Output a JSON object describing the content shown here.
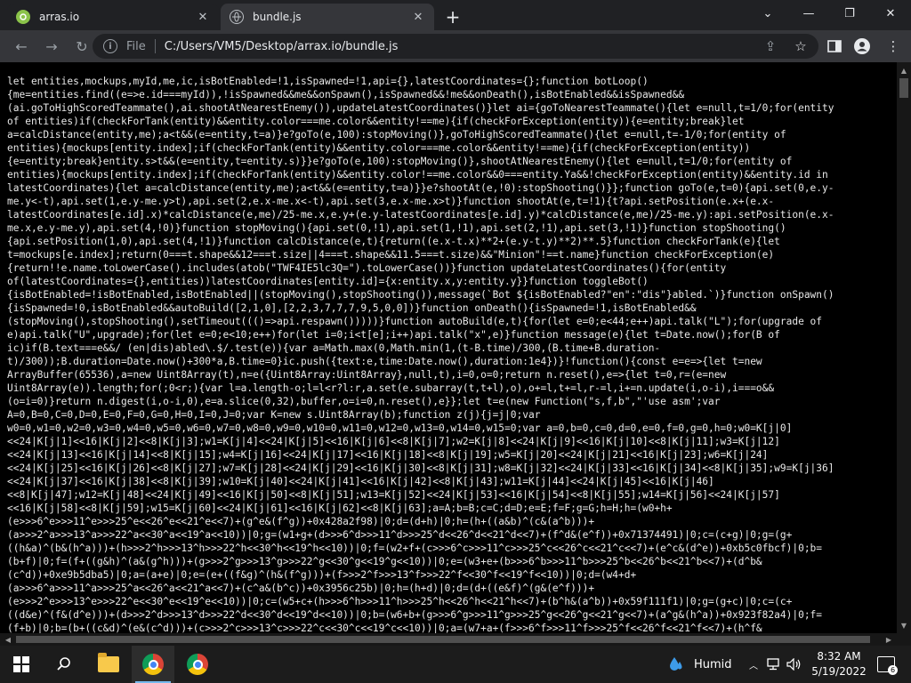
{
  "browser": {
    "tabs": [
      {
        "title": "arras.io",
        "active": false,
        "icon": "arras-icon"
      },
      {
        "title": "bundle.js",
        "active": true,
        "icon": "globe-icon"
      }
    ],
    "address": {
      "scheme": "File",
      "url": "C:/Users/VM5/Desktop/arrax.io/bundle.js"
    }
  },
  "code_lines": [
    "let entities,mockups,myId,me,ic,isBotEnabled=!1,isSpawned=!1,api={},latestCoordinates={};function botLoop()",
    "{me=entities.find((e=>e.id===myId)),!isSpawned&&me&&onSpawn(),isSpawned&&!me&&onDeath(),isBotEnabled&&isSpawned&&",
    "(ai.goToHighScoredTeammate(),ai.shootAtNearestEnemy()),updateLatestCoordinates()}let ai={goToNearestTeammate(){let e=null,t=1/0;for(entity",
    "of entities)if(checkForTank(entity)&&entity.color===me.color&&entity!==me){if(checkForException(entity)){e=entity;break}let",
    "a=calcDistance(entity,me);a<t&&(e=entity,t=a)}e?goTo(e,100):stopMoving()},goToHighScoredTeammate(){let e=null,t=-1/0;for(entity of",
    "entities){mockups[entity.index];if(checkForTank(entity)&&entity.color===me.color&&entity!==me){if(checkForException(entity))",
    "{e=entity;break}entity.s>t&&(e=entity,t=entity.s)}}e?goTo(e,100):stopMoving()},shootAtNearestEnemy(){let e=null,t=1/0;for(entity of",
    "entities){mockups[entity.index];if(checkForTank(entity)&&entity.color!==me.color&&0===entity.Ya&&!checkForException(entity)&&entity.id in",
    "latestCoordinates){let a=calcDistance(entity,me);a<t&&(e=entity,t=a)}}e?shootAt(e,!0):stopShooting()}};function goTo(e,t=0){api.set(0,e.y-",
    "me.y<-t),api.set(1,e.y-me.y>t),api.set(2,e.x-me.x<-t),api.set(3,e.x-me.x>t)}function shootAt(e,t=!1){t?api.setPosition(e.x+(e.x-",
    "latestCoordinates[e.id].x)*calcDistance(e,me)/25-me.x,e.y+(e.y-latestCoordinates[e.id].y)*calcDistance(e,me)/25-me.y):api.setPosition(e.x-",
    "me.x,e.y-me.y),api.set(4,!0)}function stopMoving(){api.set(0,!1),api.set(1,!1),api.set(2,!1),api.set(3,!1)}function stopShooting()",
    "{api.setPosition(1,0),api.set(4,!1)}function calcDistance(e,t){return((e.x-t.x)**2+(e.y-t.y)**2)**.5}function checkForTank(e){let",
    "t=mockups[e.index];return(0===t.shape&&12===t.size||4===t.shape&&11.5===t.size)&&\"Minion\"!==t.name}function checkForException(e)",
    "{return!!e.name.toLowerCase().includes(atob(\"TWF4IE5lc3Q=\").toLowerCase())}function updateLatestCoordinates(){for(entity",
    "of(latestCoordinates={},entities))latestCoordinates[entity.id]={x:entity.x,y:entity.y}}function toggleBot()",
    "{isBotEnabled=!isBotEnabled,isBotEnabled||(stopMoving(),stopShooting()),message(`Bot ${isBotEnabled?\"en\":\"dis\"}abled.`)}function onSpawn()",
    "{isSpawned=!0,isBotEnabled&&autoBuild([2,1,0],[2,2,3,7,7,7,9,5,0,0])}function onDeath(){isSpawned=!1,isBotEnabled&&",
    "(stopMoving(),stopShooting(),setTimeout((()=>api.respawn()))))}function autoBuild(e,t){for(let e=0;e<44;e++)api.talk(\"L\");for(upgrade of",
    "e)api.talk(\"U\",upgrade);for(let e=0;e<10;e++)for(let i=0;i<t[e];i++)api.talk(\"x\",e)}function message(e){let t=Date.now();for(B of",
    "ic)if(B.text===e&&/ (en|dis)abled\\.$/.test(e)){var a=Math.max(0,Math.min(1,(t-B.time)/300,(B.time+B.duration-",
    "t)/300));B.duration=Date.now()+300*a,B.time=0}ic.push({text:e,time:Date.now(),duration:1e4})}!function(){const e=e=>{let t=new",
    "ArrayBuffer(65536),a=new Uint8Array(t),n=e({Uint8Array:Uint8Array},null,t),i=0,o=0;return n.reset(),e=>{let t=0,r=(e=new",
    "Uint8Array(e)).length;for(;0<r;){var l=a.length-o;l=l<r?l:r,a.set(e.subarray(t,t+l),o),o+=l,t+=l,r-=l,i+=n.update(i,o-i),i===o&&",
    "(o=i=0)}return n.digest(i,o-i,0),e=a.slice(0,32),buffer,o=i=0,n.reset(),e}};let t=e(new Function(\"s,f,b\",\"'use asm';var",
    "A=0,B=0,C=0,D=0,E=0,F=0,G=0,H=0,I=0,J=0;var K=new s.Uint8Array(b);function z(j){j=j|0;var",
    "w0=0,w1=0,w2=0,w3=0,w4=0,w5=0,w6=0,w7=0,w8=0,w9=0,w10=0,w11=0,w12=0,w13=0,w14=0,w15=0;var a=0,b=0,c=0,d=0,e=0,f=0,g=0,h=0;w0=K[j|0]",
    "<<24|K[j|1]<<16|K[j|2]<<8|K[j|3];w1=K[j|4]<<24|K[j|5]<<16|K[j|6]<<8|K[j|7];w2=K[j|8]<<24|K[j|9]<<16|K[j|10]<<8|K[j|11];w3=K[j|12]",
    "<<24|K[j|13]<<16|K[j|14]<<8|K[j|15];w4=K[j|16]<<24|K[j|17]<<16|K[j|18]<<8|K[j|19];w5=K[j|20]<<24|K[j|21]<<16|K[j|23];w6=K[j|24]",
    "<<24|K[j|25]<<16|K[j|26]<<8|K[j|27];w7=K[j|28]<<24|K[j|29]<<16|K[j|30]<<8|K[j|31];w8=K[j|32]<<24|K[j|33]<<16|K[j|34]<<8|K[j|35];w9=K[j|36]",
    "<<24|K[j|37]<<16|K[j|38]<<8|K[j|39];w10=K[j|40]<<24|K[j|41]<<16|K[j|42]<<8|K[j|43];w11=K[j|44]<<24|K[j|45]<<16|K[j|46]",
    "<<8|K[j|47];w12=K[j|48]<<24|K[j|49]<<16|K[j|50]<<8|K[j|51];w13=K[j|52]<<24|K[j|53]<<16|K[j|54]<<8|K[j|55];w14=K[j|56]<<24|K[j|57]",
    "<<16|K[j|58]<<8|K[j|59];w15=K[j|60]<<24|K[j|61]<<16|K[j|62]<<8|K[j|63];a=A;b=B;c=C;d=D;e=E;f=F;g=G;h=H;h=(w0+h+",
    "(e>>>6^e>>>11^e>>>25^e<<26^e<<21^e<<7)+(g^e&(f^g))+0x428a2f98)|0;d=(d+h)|0;h=(h+((a&b)^(c&(a^b)))+",
    "(a>>>2^a>>>13^a>>>22^a<<30^a<<19^a<<10))|0;g=(w1+g+(d>>>6^d>>>11^d>>>25^d<<26^d<<21^d<<7)+(f^d&(e^f))+0x71374491)|0;c=(c+g)|0;g=(g+",
    "((h&a)^(b&(h^a)))+(h>>>2^h>>>13^h>>>22^h<<30^h<<19^h<<10))|0;f=(w2+f+(c>>>6^c>>>11^c>>>25^c<<26^c<<21^c<<7)+(e^c&(d^e))+0xb5c0fbcf)|0;b=",
    "(b+f)|0;f=(f+((g&h)^(a&(g^h)))+(g>>>2^g>>>13^g>>>22^g<<30^g<<19^g<<10))|0;e=(w3+e+(b>>>6^b>>>11^b>>>25^b<<26^b<<21^b<<7)+(d^b&",
    "(c^d))+0xe9b5dba5)|0;a=(a+e)|0;e=(e+((f&g)^(h&(f^g)))+(f>>>2^f>>>13^f>>>22^f<<30^f<<19^f<<10))|0;d=(w4+d+",
    "(a>>>6^a>>>11^a>>>25^a<<26^a<<21^a<<7)+(c^a&(b^c))+0x3956c25b)|0;h=(h+d)|0;d=(d+((e&f)^(g&(e^f)))+",
    "(e>>>2^e>>>13^e>>>22^e<<30^e<<19^e<<10))|0;c=(w5+c+(h>>>6^h>>>11^h>>>25^h<<26^h<<21^h<<7)+(b^h&(a^b))+0x59f111f1)|0;g=(g+c)|0;c=(c+",
    "((d&e)^(f&(d^e)))+(d>>>2^d>>>13^d>>>22^d<<30^d<<19^d<<10))|0;b=(w6+b+(g>>>6^g>>>11^g>>>25^g<<26^g<<21^g<<7)+(a^g&(h^a))+0x923f82a4)|0;f=",
    "(f+b)|0;b=(b+((c&d)^(e&(c^d)))+(c>>>2^c>>>13^c>>>22^c<<30^c<<19^c<<10))|0;a=(w7+a+(f>>>6^f>>>11^f>>>25^f<<26^f<<21^f<<7)+(h^f&"
  ],
  "taskbar": {
    "weather": "Humid",
    "time": "8:32 AM",
    "date": "5/19/2022",
    "notification_count": "6"
  },
  "colors": {
    "tabstrip": "#202124",
    "toolbar": "#35363a",
    "content_bg": "#000000",
    "code_text": "#e8e8e8",
    "taskbar": "#1c1c1c"
  }
}
